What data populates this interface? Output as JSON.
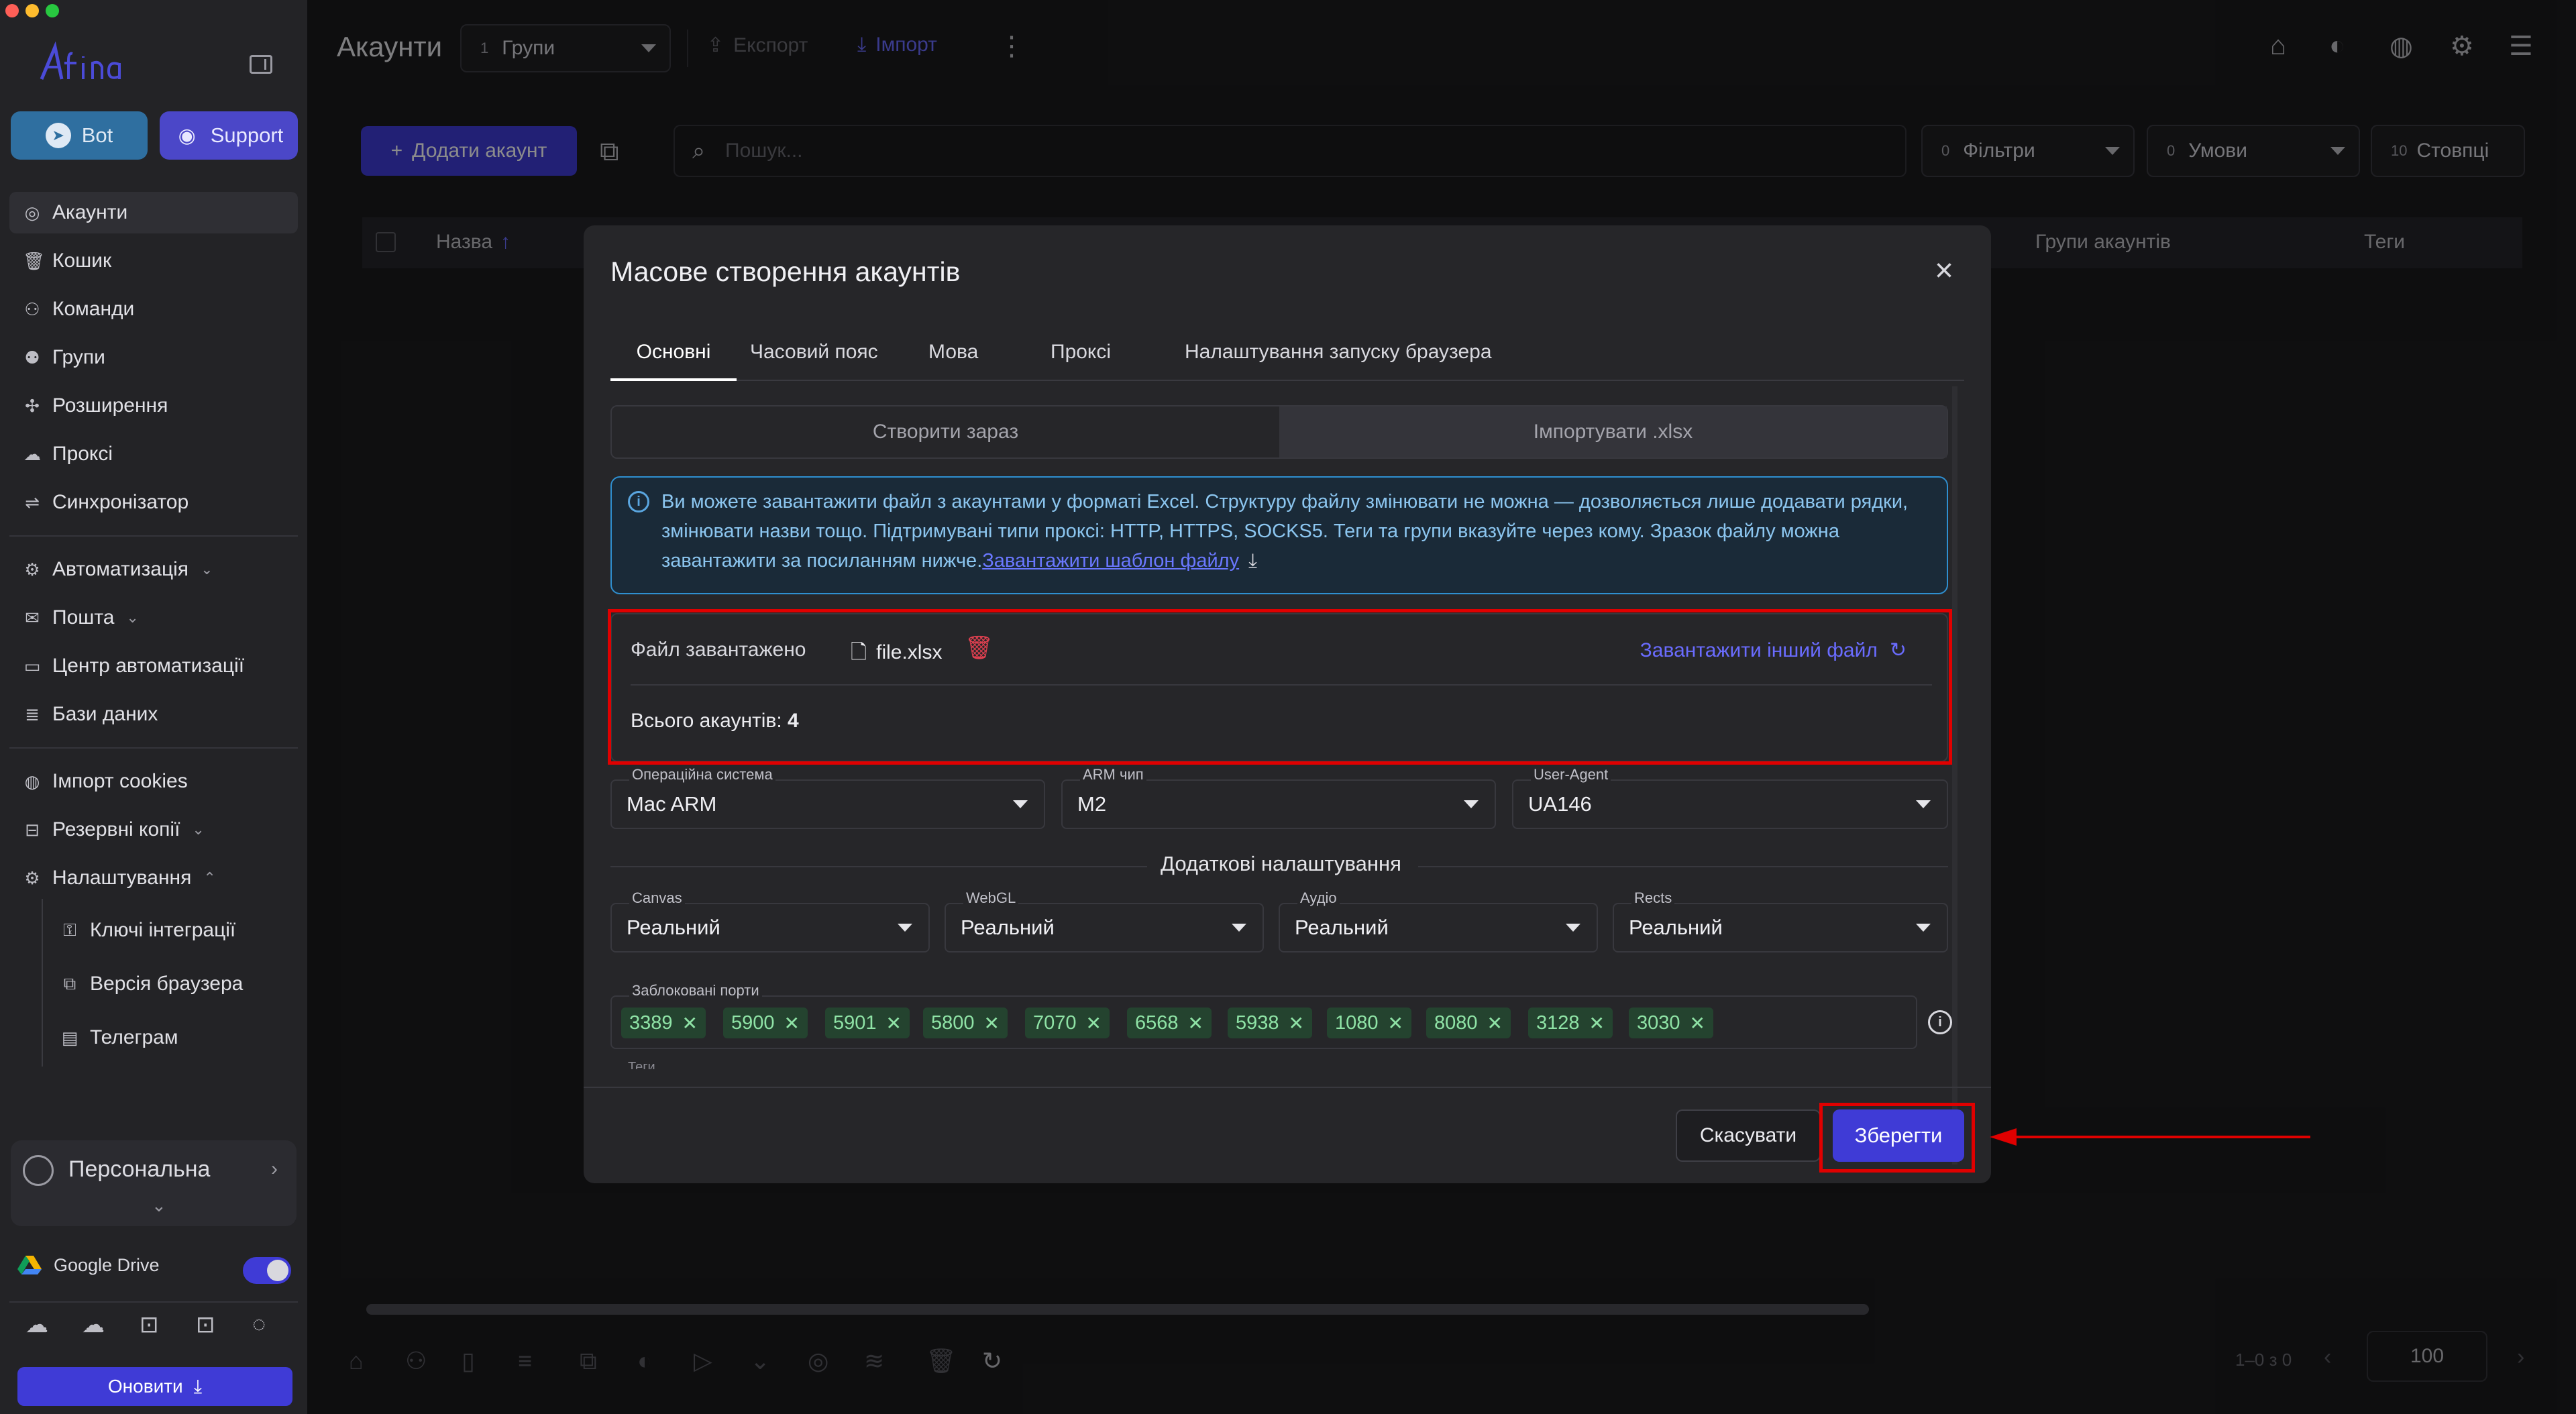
{
  "sidebar": {
    "buttons": {
      "bot": "Bot",
      "support": "Support"
    },
    "items": [
      {
        "label": "Акаунти",
        "icon": "user-circle-icon"
      },
      {
        "label": "Кошик",
        "icon": "trash-icon"
      },
      {
        "label": "Команди",
        "icon": "team-icon"
      },
      {
        "label": "Групи",
        "icon": "group-icon"
      },
      {
        "label": "Розширення",
        "icon": "puzzle-icon"
      },
      {
        "label": "Проксі",
        "icon": "cloud-icon"
      },
      {
        "label": "Синхронізатор",
        "icon": "sync-icon"
      },
      {
        "label": "Автоматизація",
        "icon": "automation-icon"
      },
      {
        "label": "Пошта",
        "icon": "mail-icon"
      },
      {
        "label": "Центр автоматизації",
        "icon": "laptop-icon"
      },
      {
        "label": "Бази даних",
        "icon": "database-icon"
      },
      {
        "label": "Імпорт cookies",
        "icon": "cookie-icon"
      },
      {
        "label": "Резервні копії",
        "icon": "backup-icon"
      },
      {
        "label": "Налаштування",
        "icon": "gear-icon"
      }
    ],
    "subitems": [
      {
        "label": "Ключі інтеграції",
        "icon": "key-icon"
      },
      {
        "label": "Версія браузера",
        "icon": "browser-icon"
      },
      {
        "label": "Телеграм",
        "icon": "chat-icon"
      }
    ],
    "workspace": "Персональна",
    "google_drive": "Google Drive",
    "update_button": "Оновити"
  },
  "topbar": {
    "title": "Акаунти",
    "groups_count": "1",
    "groups_label": "Групи",
    "export": "Експорт",
    "import": "Імпорт"
  },
  "toolbar": {
    "add_account": "Додати акаунт",
    "search_placeholder": "Пошук...",
    "filters_count": "0",
    "filters": "Фільтри",
    "conditions_count": "0",
    "conditions": "Умови",
    "columns_count": "10",
    "columns": "Стовпці"
  },
  "table": {
    "col_name": "Назва",
    "col_groups": "Групи акаунтів",
    "col_tags": "Теги"
  },
  "pagination": {
    "range": "1–0 з 0",
    "per_page": "100"
  },
  "modal": {
    "title": "Масове створення акаунтів",
    "tabs": [
      "Основні",
      "Часовий пояс",
      "Мова",
      "Проксі",
      "Налаштування запуску браузера"
    ],
    "segment": [
      "Створити зараз",
      "Імпортувати .xlsx"
    ],
    "info_text": "Ви можете завантажити файл з акаунтами у форматі Excel. Структуру файлу змінювати не можна — дозволяється лише додавати рядки, змінювати назви тощо. Підтримувані типи проксі: HTTP, HTTPS, SOCKS5. Теги та групи вказуйте через кому. Зразок файлу можна завантажити за посиланням нижче.",
    "info_link": "Завантажити шаблон файлу",
    "file_uploaded_label": "Файл завантажено",
    "file_name": "file.xlsx",
    "upload_other": "Завантажити інший файл",
    "total_label": "Всього акаунтів:",
    "total_value": "4",
    "os_label": "Операційна система",
    "os_value": "Mac ARM",
    "arm_label": "ARM чип",
    "arm_value": "M2",
    "ua_label": "User-Agent",
    "ua_value": "UA146",
    "extra_section": "Додаткові налаштування",
    "canvas_label": "Canvas",
    "canvas_value": "Реальний",
    "webgl_label": "WebGL",
    "webgl_value": "Реальний",
    "audio_label": "Аудіо",
    "audio_value": "Реальний",
    "rects_label": "Rects",
    "rects_value": "Реальний",
    "ports_label": "Заблоковані порти",
    "ports": [
      "3389",
      "5900",
      "5901",
      "5800",
      "7070",
      "6568",
      "5938",
      "1080",
      "8080",
      "3128",
      "3030"
    ],
    "tags_label": "Теги",
    "cancel": "Скасувати",
    "save": "Зберегти"
  },
  "colors": {
    "accent": "#3f3bd6",
    "highlight": "#e00000",
    "chip_text": "#8fe3a6",
    "info_border": "#2f8fd0"
  }
}
